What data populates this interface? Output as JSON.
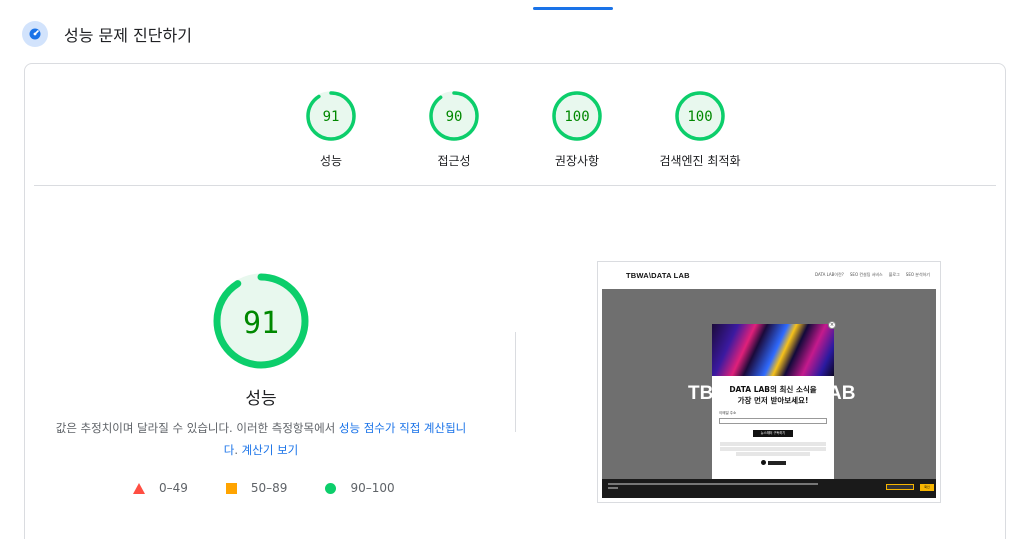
{
  "section": {
    "title": "성능 문제 진단하기",
    "icon": "speedometer-icon",
    "accent": "#1a73e8"
  },
  "categories": [
    {
      "label": "성능",
      "score": 91
    },
    {
      "label": "접근성",
      "score": 90
    },
    {
      "label": "권장사항",
      "score": 100
    },
    {
      "label": "검색엔진 최적화",
      "score": 100
    }
  ],
  "main_score": {
    "score": 91,
    "label": "성능",
    "disclaimer_prefix": "값은 추정치이며 달라질 수 있습니다. 이러한 측정항목에서 ",
    "disclaimer_link": "성능 점수가 직접 계산됩니다",
    "disclaimer_suffix": ". ",
    "calculator_link": "계산기 보기"
  },
  "legend": [
    {
      "range": "0–49",
      "icon": "triangle-fail-icon",
      "color": "#ff4e42"
    },
    {
      "range": "50–89",
      "icon": "square-average-icon",
      "color": "#ffa400"
    },
    {
      "range": "90–100",
      "icon": "circle-pass-icon",
      "color": "#0cce6b"
    }
  ],
  "colors": {
    "pass": "#0cce6b",
    "pass_text": "#008800",
    "pass_fill": "#e8f8ee"
  },
  "screenshot": {
    "logo": "TBWA\\DATA LAB",
    "menu": [
      "DATA LAB이란?",
      "SEO 컨설팅 서비스",
      "블로그",
      "SEO 분석하기"
    ],
    "hero_left": "TBW",
    "hero_right": "AB",
    "popup_title_1": "DATA LAB의 최신 소식을",
    "popup_title_2": "가장 먼저 받아보세요!",
    "popup_email_label": "이메일 주소",
    "popup_subscribe": "뉴스레터 구독하기",
    "popup_close": "×",
    "footer_accept": "확인"
  }
}
